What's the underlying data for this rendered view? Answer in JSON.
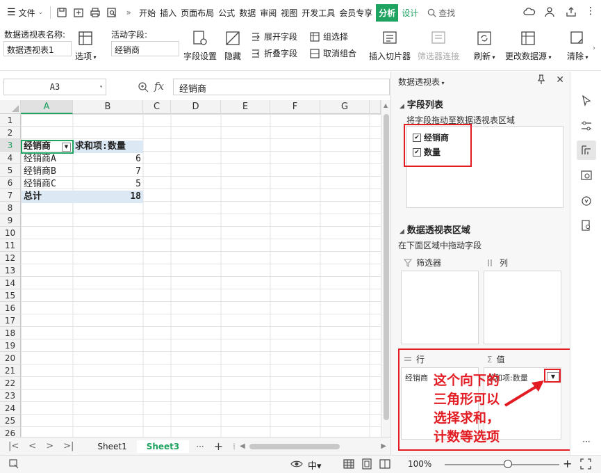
{
  "menubar": {
    "file_label": "文件",
    "tabs": [
      "开始",
      "插入",
      "页面布局",
      "公式",
      "数据",
      "审阅",
      "视图",
      "开发工具",
      "会员专享"
    ],
    "active_tab": "分析",
    "design_tab": "设计",
    "search_label": "查找"
  },
  "ribbon": {
    "pivot_name_label": "数据透视表名称:",
    "pivot_name_value": "数据透视表1",
    "options_label": "选项",
    "active_field_label": "活动字段:",
    "active_field_value": "经销商",
    "field_settings": "字段设置",
    "hide": "隐藏",
    "expand_field": "展开字段",
    "collapse_field": "折叠字段",
    "group_selection": "组选择",
    "ungroup": "取消组合",
    "insert_slicer": "插入切片器",
    "filter_connections": "筛选器连接",
    "refresh": "刷新",
    "change_source": "更改数据源",
    "clear": "清除"
  },
  "formula_bar": {
    "name_box": "A3",
    "fx": "fx",
    "content": "经销商"
  },
  "grid": {
    "columns": [
      "A",
      "B",
      "C",
      "D",
      "E",
      "F",
      "G"
    ],
    "rows": [
      "1",
      "2",
      "3",
      "4",
      "5",
      "6",
      "7",
      "8",
      "9",
      "10",
      "11",
      "12",
      "13",
      "14",
      "15",
      "16",
      "17",
      "18",
      "19",
      "20",
      "21",
      "22",
      "23",
      "24",
      "25",
      "26"
    ],
    "pivot_header": [
      "经销商",
      "求和项:数量"
    ],
    "pivot_rows": [
      {
        "name": "经销商A",
        "value": "6"
      },
      {
        "name": "经销商B",
        "value": "7"
      },
      {
        "name": "经销商C",
        "value": "5"
      }
    ],
    "total": {
      "name": "总计",
      "value": "18"
    }
  },
  "sheets": {
    "tabs": [
      "Sheet1",
      "Sheet3"
    ],
    "active": "Sheet3"
  },
  "status": {
    "zoom": "100%"
  },
  "panel": {
    "title": "数据透视表",
    "field_list_title": "字段列表",
    "field_list_hint": "将字段拖动至数据透视表区域",
    "fields": [
      "经销商",
      "数量"
    ],
    "areas_title": "数据透视表区域",
    "areas_hint": "在下面区域中拖动字段",
    "filter_label": "筛选器",
    "column_label": "列",
    "row_label": "行",
    "value_label": "值",
    "row_chip": "经销商",
    "value_chip": "求和项:数量"
  },
  "annotation": {
    "text": "这个向下的三角形可以选择求和，计数等选项"
  },
  "colors": {
    "accent": "#1ea361",
    "annotation": "#e31b23",
    "header_band": "#dde8f5"
  }
}
